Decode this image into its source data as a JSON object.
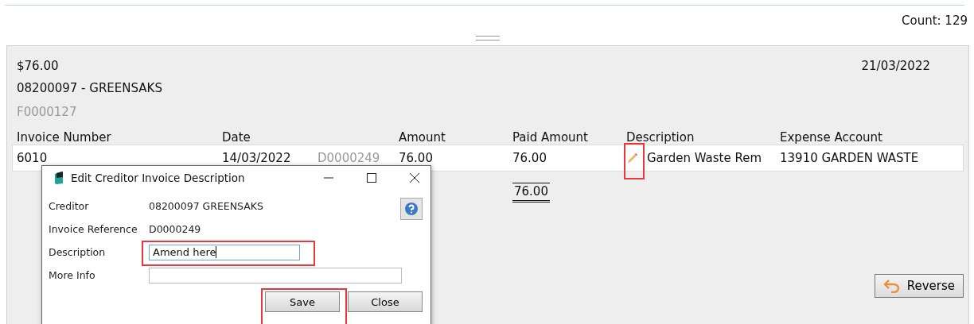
{
  "count": "Count: 129",
  "summary": {
    "amount": "$76.00",
    "creditor": "08200097  -  GREENSAKS",
    "reference": "F0000127",
    "date": "21/03/2022"
  },
  "table": {
    "columns": [
      "Invoice Number",
      "Date",
      "Amount",
      "Paid Amount",
      "Description",
      "Expense Account"
    ],
    "rows": [
      {
        "invoice_number": "6010",
        "date": "14/03/2022",
        "reference": "D0000249",
        "amount": "76.00",
        "paid_amount": "76.00",
        "description": "Garden Waste Rem",
        "expense_account": "13910 GARDEN WASTE"
      }
    ],
    "total": "76.00"
  },
  "reverse_button": "Reverse",
  "dialog": {
    "title": "Edit Creditor Invoice Description",
    "fields": [
      {
        "kind": "text",
        "label": "Creditor",
        "value": "08200097 GREENSAKS"
      },
      {
        "kind": "text",
        "label": "Invoice Reference",
        "value": "D0000249"
      },
      {
        "kind": "input",
        "label": "Description",
        "value": "Amend here",
        "focused": true
      },
      {
        "kind": "input",
        "label": "More Info",
        "focused": false
      }
    ],
    "buttons": [
      "Save",
      "Close"
    ]
  }
}
